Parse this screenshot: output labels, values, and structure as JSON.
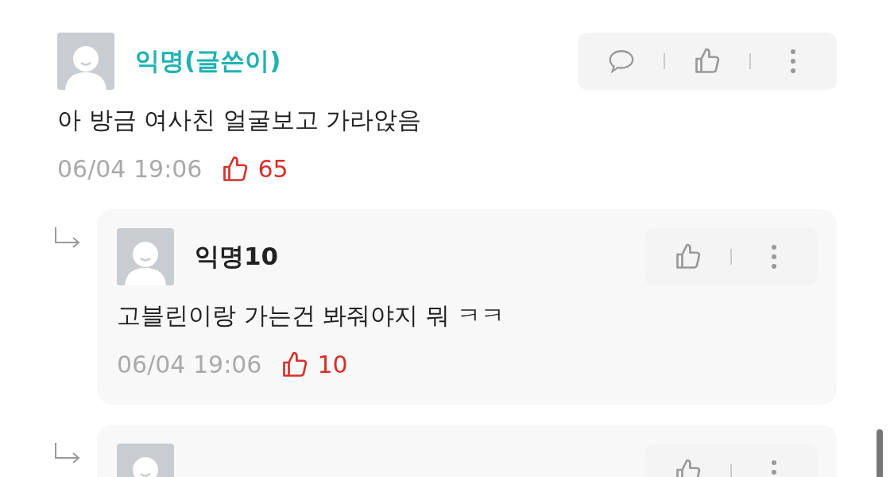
{
  "comments": [
    {
      "author": "익명(글쓴이)",
      "is_author": true,
      "body": "아 방금 여사친 얼굴보고 가라앉음",
      "time": "06/04 19:06",
      "likes": "65",
      "actions": [
        {
          "kind": "reply"
        },
        {
          "kind": "like"
        },
        {
          "kind": "more"
        }
      ],
      "replies": [
        {
          "author": "익명10",
          "is_author": false,
          "body": "고블린이랑 가는건 봐줘야지 뭐 ㅋㅋ",
          "time": "06/04 19:06",
          "likes": "10",
          "actions": [
            {
              "kind": "like"
            },
            {
              "kind": "more"
            }
          ]
        },
        {
          "actions": [
            {
              "kind": "like"
            },
            {
              "kind": "more"
            }
          ]
        }
      ]
    }
  ]
}
